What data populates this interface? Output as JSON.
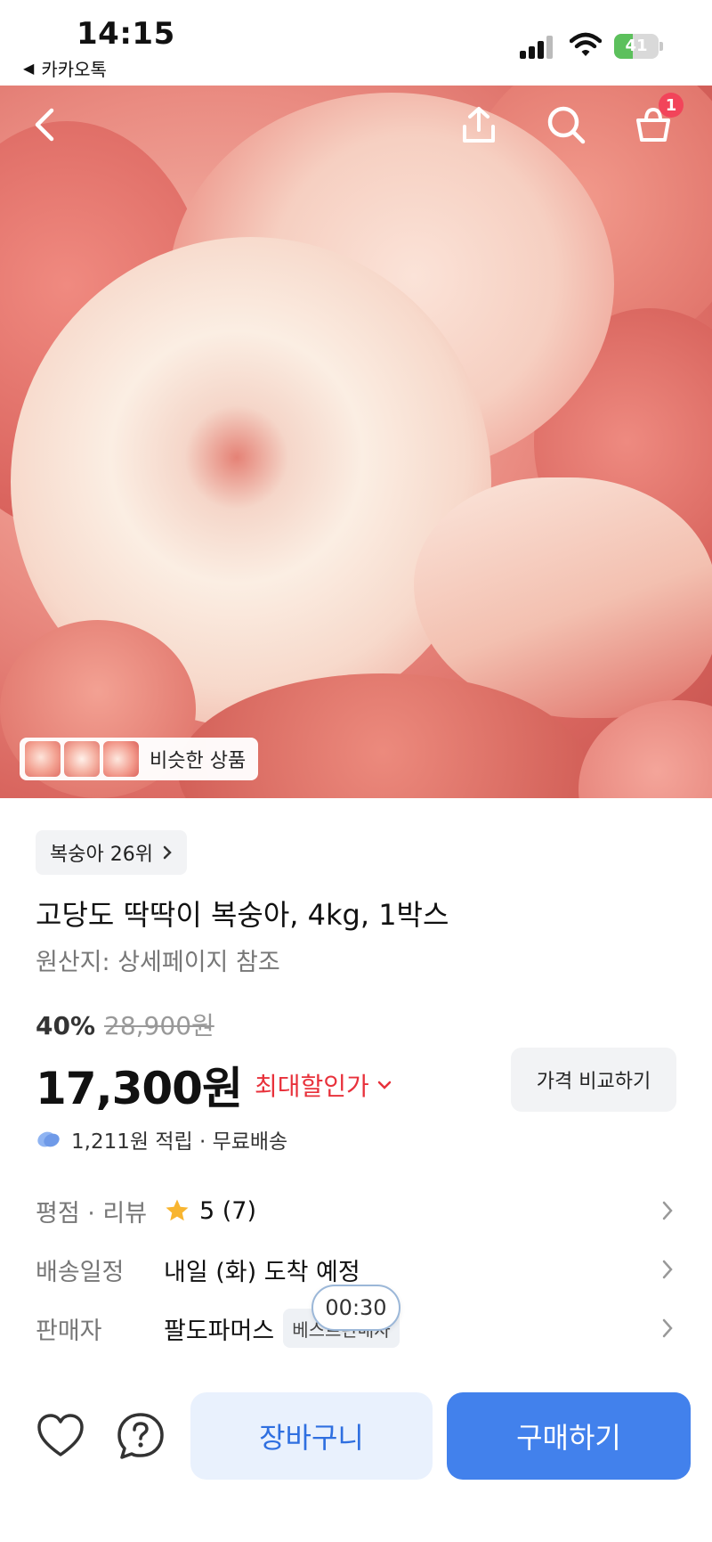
{
  "status_bar": {
    "time": "14:15",
    "back_app": "카카오톡",
    "battery_level": 41,
    "battery_text": "41"
  },
  "hero": {
    "similar_label": "비슷한 상품",
    "cart_count": "1"
  },
  "product": {
    "rank_label": "복숭아 26위",
    "title": "고당도 딱딱이 복숭아, 4kg, 1박스",
    "origin": "원산지: 상세페이지 참조",
    "discount_pct": "40%",
    "original_price": "28,900원",
    "price": "17,300원",
    "max_discount": "최대할인가",
    "compare_label": "가격 비교하기",
    "points_text": "1,211원 적립 · 무료배송"
  },
  "info": {
    "rating_key": "평점 · 리뷰",
    "rating_value": "5 (7)",
    "delivery_key": "배송일정",
    "delivery_value": "내일 (화) 도착 예정",
    "seller_key": "판매자",
    "seller_value": "팔도파머스",
    "seller_badge": "베스트판매자"
  },
  "timer": "00:30",
  "bottom": {
    "cart_label": "장바구니",
    "buy_label": "구매하기"
  },
  "colors": {
    "accent_blue": "#4281ec",
    "sale_red": "#e8313b",
    "badge_red": "#f2445a"
  }
}
